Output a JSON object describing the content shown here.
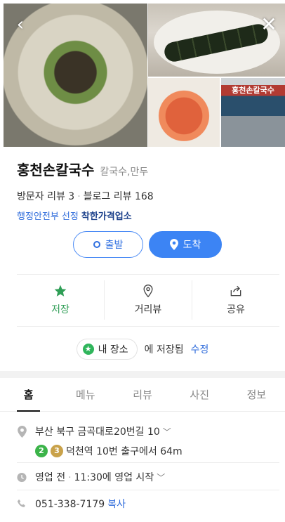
{
  "nav": {
    "back_icon": "‹",
    "close_icon": "✕"
  },
  "photos": {
    "store_sign": "홍천손칼국수"
  },
  "place": {
    "name": "홍천손칼국수",
    "category": "칼국수,만두",
    "visitor_reviews": "방문자 리뷰 3",
    "blog_reviews": "블로그 리뷰 168",
    "badge_prefix": "행정안전부 선정",
    "badge_strong": "착한가격업소"
  },
  "route": {
    "start_label": "출발",
    "arrive_label": "도착"
  },
  "actions": [
    {
      "label": "저장",
      "icon": "star-icon"
    },
    {
      "label": "거리뷰",
      "icon": "pin-outline-icon"
    },
    {
      "label": "공유",
      "icon": "share-icon"
    }
  ],
  "saved": {
    "chip_label": "내 장소",
    "saved_text": "에 저장됨",
    "edit_label": "수정"
  },
  "tabs": [
    "홈",
    "메뉴",
    "리뷰",
    "사진",
    "정보"
  ],
  "active_tab": "홈",
  "info": {
    "address": "부산 북구 금곡대로20번길 10",
    "subway_lines": [
      "2",
      "3"
    ],
    "subway_colors": [
      "#3cb44a",
      "#c9a24a"
    ],
    "subway_text": "덕천역 10번 출구에서 64m",
    "hours_status": "영업 전",
    "hours_detail": "11:30에 영업 시작",
    "phone": "051-338-7179",
    "copy_label": "복사"
  },
  "colors": {
    "accent": "#3c84f4",
    "save_green": "#2f9e56",
    "link_blue": "#2e6bdb"
  }
}
